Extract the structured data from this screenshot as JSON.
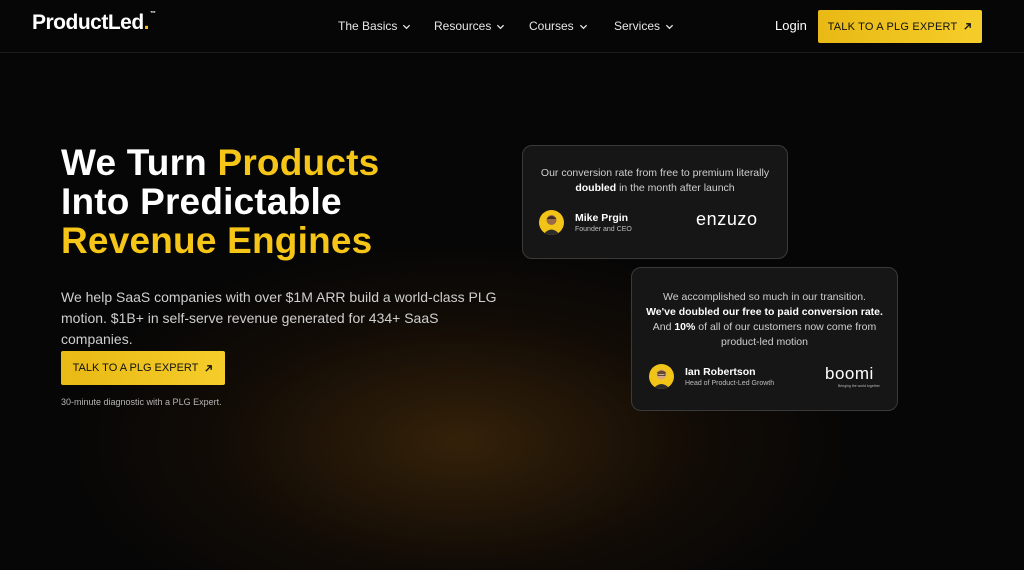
{
  "nav": {
    "logo_text": "ProductLed",
    "logo_dot": ".",
    "logo_tm": "™",
    "items": [
      {
        "label": "The Basics"
      },
      {
        "label": "Resources"
      },
      {
        "label": "Courses"
      },
      {
        "label": "Services"
      }
    ],
    "login": "Login",
    "cta": "TALK TO A PLG EXPERT"
  },
  "hero": {
    "line1_white": "We Turn ",
    "line1_yellow": "Products",
    "line2": "Into Predictable",
    "line3": "Revenue Engines",
    "subtitle": "We help SaaS companies with over $1M ARR build a world-class PLG motion. $1B+ in self-serve revenue generated for 434+ SaaS companies.",
    "cta": "TALK TO A PLG EXPERT",
    "note": "30-minute diagnostic with a PLG Expert."
  },
  "testimonials": [
    {
      "quote_a": "Our conversion rate from free to premium literally ",
      "quote_bold": "doubled",
      "quote_b": " in the month after launch",
      "name": "Mike Prgin",
      "role": "Founder and CEO",
      "company": "enzuzo"
    },
    {
      "quote_a": "We accomplished so much in our transition.",
      "quote_bold": "We've doubled our free to paid conversion rate.",
      "quote_b": "And ",
      "quote_bold2": "10%",
      "quote_c": " of all of our customers now come from product-led motion",
      "name": "Ian Robertson",
      "role": "Head of Product-Led Growth",
      "company": "boomi",
      "company_tagline": "Bringing the world together"
    }
  ],
  "colors": {
    "accent": "#f5c518",
    "background": "#060606",
    "card": "#161616"
  }
}
